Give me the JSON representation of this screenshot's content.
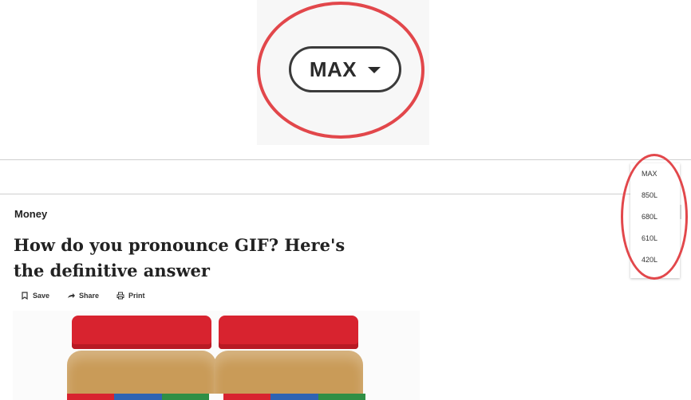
{
  "zoom": {
    "button_label": "MAX"
  },
  "article": {
    "category": "Money",
    "title": "How do you pronounce GIF? Here's the definitive answer",
    "actions": [
      {
        "label": "Save",
        "icon": "bookmark-icon"
      },
      {
        "label": "Share",
        "icon": "share-arrow-icon"
      },
      {
        "label": "Print",
        "icon": "printer-icon"
      }
    ]
  },
  "dropdown": {
    "options": [
      "MAX",
      "850L",
      "680L",
      "610L",
      "420L"
    ]
  },
  "colors": {
    "highlight": "#e2474b",
    "lid": "#d8232f",
    "peanut_butter": "#c99b58",
    "band": [
      "#d8232f",
      "#2e63b3",
      "#2f8f45"
    ]
  }
}
